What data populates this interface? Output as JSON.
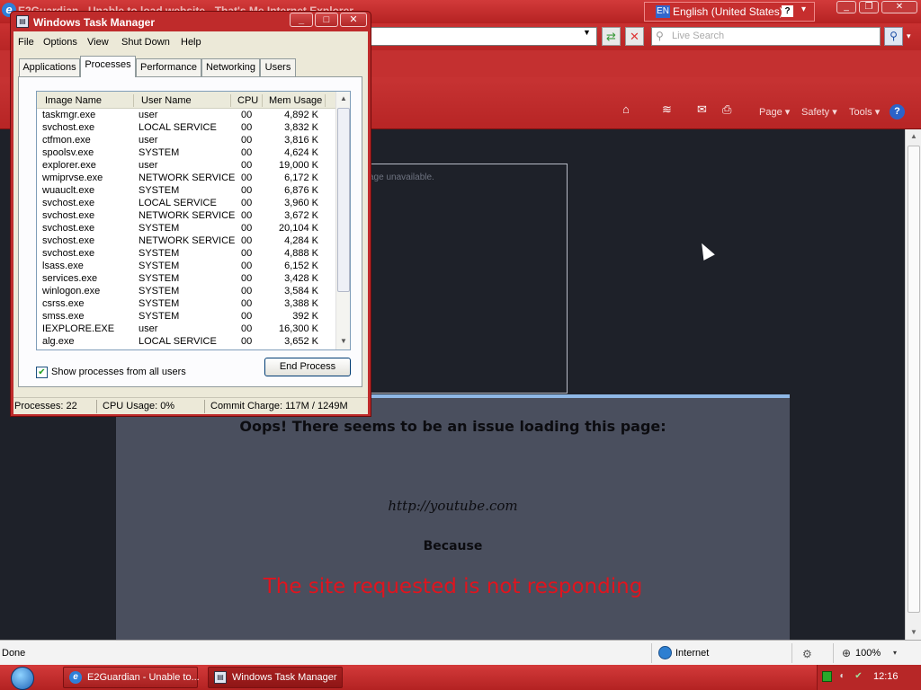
{
  "ie": {
    "title": "E2Guardian - Unable to load website - That's Me Internet Explorer",
    "app_icon": "internet-explorer-icon",
    "language_bar": {
      "code": "EN",
      "language": "English (United States)",
      "help": "?",
      "menu_glyph": "▾"
    },
    "window_controls": {
      "minimize": "_",
      "restore": "❐",
      "close": "✕"
    },
    "address": {
      "value": "",
      "dropdown": "▼"
    },
    "refresh_glyph": "⇄",
    "stop_glyph": "✕",
    "search": {
      "placeholder": "Live Search",
      "button_glyph": "⚲",
      "options_glyph": "▾"
    },
    "command_bar": {
      "home_glyph": "⌂",
      "feeds_glyph": "≋",
      "mail_glyph": "✉",
      "print_glyph": "⎙",
      "page": "Page ▾",
      "safety": "Safety ▾",
      "tools": "Tools ▾",
      "help": "?"
    },
    "content": {
      "frame_text": "age unavailable.",
      "error_heading": "Oops! There seems to be an issue loading this page:",
      "url": "http://youtube.com",
      "because": "Because",
      "reason": "The site requested is not responding"
    },
    "status": {
      "text": "Done",
      "zone": "Internet",
      "zoom": "100%",
      "zoom_dropdown": "▾"
    }
  },
  "task_manager": {
    "title": "Windows Task Manager",
    "controls": {
      "minimize": "_",
      "maximize": "□",
      "close": "✕"
    },
    "menu": [
      "File",
      "Options",
      "View",
      "Shut Down",
      "Help"
    ],
    "tabs": [
      "Applications",
      "Processes",
      "Performance",
      "Networking",
      "Users"
    ],
    "active_tab": "Processes",
    "columns": {
      "name": "Image Name",
      "user": "User Name",
      "cpu": "CPU",
      "mem": "Mem Usage"
    },
    "processes": [
      {
        "name": "taskmgr.exe",
        "user": "user",
        "cpu": "00",
        "mem": "4,892 K"
      },
      {
        "name": "svchost.exe",
        "user": "LOCAL SERVICE",
        "cpu": "00",
        "mem": "3,832 K"
      },
      {
        "name": "ctfmon.exe",
        "user": "user",
        "cpu": "00",
        "mem": "3,816 K"
      },
      {
        "name": "spoolsv.exe",
        "user": "SYSTEM",
        "cpu": "00",
        "mem": "4,624 K"
      },
      {
        "name": "explorer.exe",
        "user": "user",
        "cpu": "00",
        "mem": "19,000 K"
      },
      {
        "name": "wmiprvse.exe",
        "user": "NETWORK SERVICE",
        "cpu": "00",
        "mem": "6,172 K"
      },
      {
        "name": "wuauclt.exe",
        "user": "SYSTEM",
        "cpu": "00",
        "mem": "6,876 K"
      },
      {
        "name": "svchost.exe",
        "user": "LOCAL SERVICE",
        "cpu": "00",
        "mem": "3,960 K"
      },
      {
        "name": "svchost.exe",
        "user": "NETWORK SERVICE",
        "cpu": "00",
        "mem": "3,672 K"
      },
      {
        "name": "svchost.exe",
        "user": "SYSTEM",
        "cpu": "00",
        "mem": "20,104 K"
      },
      {
        "name": "svchost.exe",
        "user": "NETWORK SERVICE",
        "cpu": "00",
        "mem": "4,284 K"
      },
      {
        "name": "svchost.exe",
        "user": "SYSTEM",
        "cpu": "00",
        "mem": "4,888 K"
      },
      {
        "name": "lsass.exe",
        "user": "SYSTEM",
        "cpu": "00",
        "mem": "6,152 K"
      },
      {
        "name": "services.exe",
        "user": "SYSTEM",
        "cpu": "00",
        "mem": "3,428 K"
      },
      {
        "name": "winlogon.exe",
        "user": "SYSTEM",
        "cpu": "00",
        "mem": "3,584 K"
      },
      {
        "name": "csrss.exe",
        "user": "SYSTEM",
        "cpu": "00",
        "mem": "3,388 K"
      },
      {
        "name": "smss.exe",
        "user": "SYSTEM",
        "cpu": "00",
        "mem": "392 K"
      },
      {
        "name": "IEXPLORE.EXE",
        "user": "user",
        "cpu": "00",
        "mem": "16,300 K"
      },
      {
        "name": "alg.exe",
        "user": "LOCAL SERVICE",
        "cpu": "00",
        "mem": "3,652 K"
      }
    ],
    "show_all_label": "Show processes from all users",
    "show_all_checked": true,
    "end_process": "End Process",
    "status": {
      "processes": "Processes: 22",
      "cpu": "CPU Usage: 0%",
      "commit": "Commit Charge: 117M / 1249M"
    }
  },
  "taskbar": {
    "buttons": [
      {
        "label": "E2Guardian - Unable to...",
        "icon": "internet-explorer-icon"
      },
      {
        "label": "Windows Task Manager",
        "icon": "task-manager-icon"
      }
    ],
    "clock": "12:16"
  },
  "colors": {
    "theme_red": "#c02a2a",
    "page_background": "#1e2129",
    "error_panel": "#4a4f5e",
    "error_reason": "#e0141e"
  }
}
